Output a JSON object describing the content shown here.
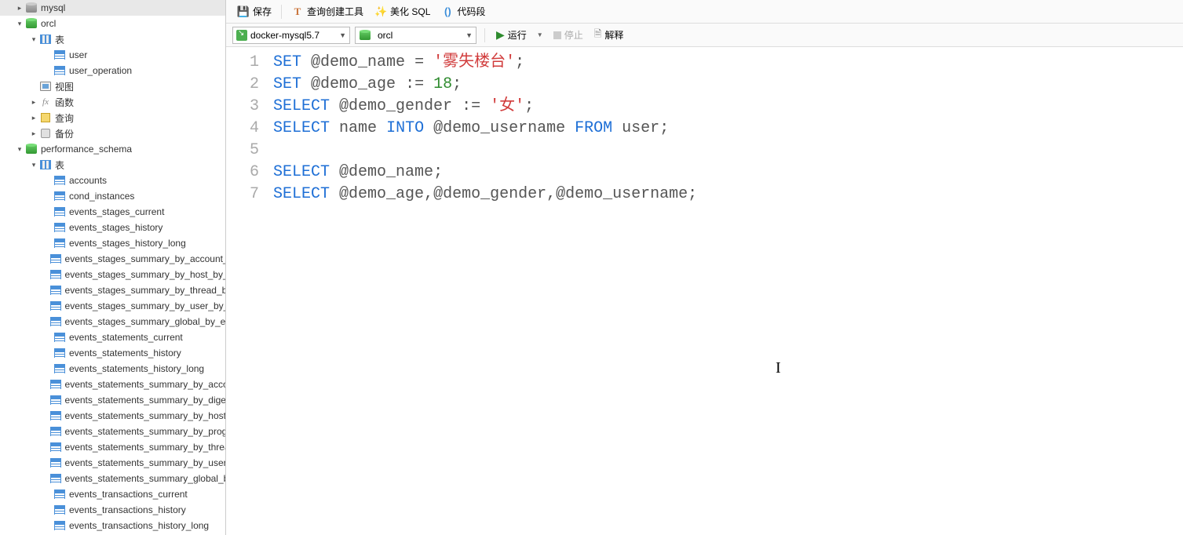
{
  "sidebar": {
    "nodes": [
      {
        "indent": 1,
        "toggle": "▸",
        "iconClass": "icon-db-grey",
        "iconName": "database-icon",
        "label": "mysql"
      },
      {
        "indent": 1,
        "toggle": "▾",
        "iconClass": "icon-db",
        "iconName": "database-icon",
        "label": "orcl"
      },
      {
        "indent": 2,
        "toggle": "▾",
        "iconClass": "icon-tables",
        "iconName": "tables-icon",
        "label": "表"
      },
      {
        "indent": 3,
        "toggle": "",
        "iconClass": "icon-table",
        "iconName": "table-icon",
        "label": "user"
      },
      {
        "indent": 3,
        "toggle": "",
        "iconClass": "icon-table",
        "iconName": "table-icon",
        "label": "user_operation"
      },
      {
        "indent": 2,
        "toggle": "",
        "iconClass": "icon-view",
        "iconName": "view-icon",
        "label": "视图"
      },
      {
        "indent": 2,
        "toggle": "▸",
        "iconClass": "icon-fx",
        "iconName": "function-icon",
        "label": "函数",
        "fx": true
      },
      {
        "indent": 2,
        "toggle": "▸",
        "iconClass": "icon-query",
        "iconName": "query-icon",
        "label": "查询"
      },
      {
        "indent": 2,
        "toggle": "▸",
        "iconClass": "icon-backup",
        "iconName": "backup-icon",
        "label": "备份"
      },
      {
        "indent": 1,
        "toggle": "▾",
        "iconClass": "icon-db",
        "iconName": "database-icon",
        "label": "performance_schema"
      },
      {
        "indent": 2,
        "toggle": "▾",
        "iconClass": "icon-tables",
        "iconName": "tables-icon",
        "label": "表"
      },
      {
        "indent": 3,
        "toggle": "",
        "iconClass": "icon-table",
        "iconName": "table-icon",
        "label": "accounts"
      },
      {
        "indent": 3,
        "toggle": "",
        "iconClass": "icon-table",
        "iconName": "table-icon",
        "label": "cond_instances"
      },
      {
        "indent": 3,
        "toggle": "",
        "iconClass": "icon-table",
        "iconName": "table-icon",
        "label": "events_stages_current"
      },
      {
        "indent": 3,
        "toggle": "",
        "iconClass": "icon-table",
        "iconName": "table-icon",
        "label": "events_stages_history"
      },
      {
        "indent": 3,
        "toggle": "",
        "iconClass": "icon-table",
        "iconName": "table-icon",
        "label": "events_stages_history_long"
      },
      {
        "indent": 3,
        "toggle": "",
        "iconClass": "icon-table",
        "iconName": "table-icon",
        "label": "events_stages_summary_by_account_by_event_name"
      },
      {
        "indent": 3,
        "toggle": "",
        "iconClass": "icon-table",
        "iconName": "table-icon",
        "label": "events_stages_summary_by_host_by_event_name"
      },
      {
        "indent": 3,
        "toggle": "",
        "iconClass": "icon-table",
        "iconName": "table-icon",
        "label": "events_stages_summary_by_thread_by_event_name"
      },
      {
        "indent": 3,
        "toggle": "",
        "iconClass": "icon-table",
        "iconName": "table-icon",
        "label": "events_stages_summary_by_user_by_event_name"
      },
      {
        "indent": 3,
        "toggle": "",
        "iconClass": "icon-table",
        "iconName": "table-icon",
        "label": "events_stages_summary_global_by_event_name"
      },
      {
        "indent": 3,
        "toggle": "",
        "iconClass": "icon-table",
        "iconName": "table-icon",
        "label": "events_statements_current"
      },
      {
        "indent": 3,
        "toggle": "",
        "iconClass": "icon-table",
        "iconName": "table-icon",
        "label": "events_statements_history"
      },
      {
        "indent": 3,
        "toggle": "",
        "iconClass": "icon-table",
        "iconName": "table-icon",
        "label": "events_statements_history_long"
      },
      {
        "indent": 3,
        "toggle": "",
        "iconClass": "icon-table",
        "iconName": "table-icon",
        "label": "events_statements_summary_by_account_by_event_name"
      },
      {
        "indent": 3,
        "toggle": "",
        "iconClass": "icon-table",
        "iconName": "table-icon",
        "label": "events_statements_summary_by_digest"
      },
      {
        "indent": 3,
        "toggle": "",
        "iconClass": "icon-table",
        "iconName": "table-icon",
        "label": "events_statements_summary_by_host_by_event_name"
      },
      {
        "indent": 3,
        "toggle": "",
        "iconClass": "icon-table",
        "iconName": "table-icon",
        "label": "events_statements_summary_by_program"
      },
      {
        "indent": 3,
        "toggle": "",
        "iconClass": "icon-table",
        "iconName": "table-icon",
        "label": "events_statements_summary_by_thread_by_event_name"
      },
      {
        "indent": 3,
        "toggle": "",
        "iconClass": "icon-table",
        "iconName": "table-icon",
        "label": "events_statements_summary_by_user_by_event_name"
      },
      {
        "indent": 3,
        "toggle": "",
        "iconClass": "icon-table",
        "iconName": "table-icon",
        "label": "events_statements_summary_global_by_event_name"
      },
      {
        "indent": 3,
        "toggle": "",
        "iconClass": "icon-table",
        "iconName": "table-icon",
        "label": "events_transactions_current"
      },
      {
        "indent": 3,
        "toggle": "",
        "iconClass": "icon-table",
        "iconName": "table-icon",
        "label": "events_transactions_history"
      },
      {
        "indent": 3,
        "toggle": "",
        "iconClass": "icon-table",
        "iconName": "table-icon",
        "label": "events_transactions_history_long"
      }
    ]
  },
  "toolbar1": {
    "save": {
      "label": "保存",
      "iconGlyph": "💾"
    },
    "queryBuilder": {
      "label": "查询创建工具",
      "iconGlyph": "T"
    },
    "beautify": {
      "label": "美化 SQL",
      "iconGlyph": "✨"
    },
    "snippet": {
      "label": "代码段",
      "iconGlyph": "()"
    }
  },
  "toolbar2": {
    "connection": "docker-mysql5.7",
    "database": "orcl",
    "run": "运行",
    "stop": "停止",
    "explain": "解释"
  },
  "editor": {
    "lines": [
      [
        {
          "t": "SET",
          "c": "kw"
        },
        {
          "t": " ",
          "c": ""
        },
        {
          "t": "@demo_name",
          "c": "var"
        },
        {
          "t": " ",
          "c": ""
        },
        {
          "t": "=",
          "c": "op"
        },
        {
          "t": " ",
          "c": ""
        },
        {
          "t": "'雾失楼台'",
          "c": "str"
        },
        {
          "t": ";",
          "c": "op"
        }
      ],
      [
        {
          "t": "SET",
          "c": "kw"
        },
        {
          "t": " ",
          "c": ""
        },
        {
          "t": "@demo_age",
          "c": "var"
        },
        {
          "t": " ",
          "c": ""
        },
        {
          "t": ":=",
          "c": "op"
        },
        {
          "t": " ",
          "c": ""
        },
        {
          "t": "18",
          "c": "num"
        },
        {
          "t": ";",
          "c": "op"
        }
      ],
      [
        {
          "t": "SELECT",
          "c": "kw"
        },
        {
          "t": " ",
          "c": ""
        },
        {
          "t": "@demo_gender",
          "c": "var"
        },
        {
          "t": " ",
          "c": ""
        },
        {
          "t": ":=",
          "c": "op"
        },
        {
          "t": " ",
          "c": ""
        },
        {
          "t": "'女'",
          "c": "str"
        },
        {
          "t": ";",
          "c": "op"
        }
      ],
      [
        {
          "t": "SELECT",
          "c": "kw"
        },
        {
          "t": " ",
          "c": ""
        },
        {
          "t": "name",
          "c": "ident"
        },
        {
          "t": " ",
          "c": ""
        },
        {
          "t": "INTO",
          "c": "kw"
        },
        {
          "t": " ",
          "c": ""
        },
        {
          "t": "@demo_username",
          "c": "var"
        },
        {
          "t": " ",
          "c": ""
        },
        {
          "t": "FROM",
          "c": "kw"
        },
        {
          "t": " ",
          "c": ""
        },
        {
          "t": "user",
          "c": "ident"
        },
        {
          "t": ";",
          "c": "op"
        }
      ],
      [],
      [
        {
          "t": "SELECT",
          "c": "kw"
        },
        {
          "t": " ",
          "c": ""
        },
        {
          "t": "@demo_name",
          "c": "var"
        },
        {
          "t": ";",
          "c": "op"
        }
      ],
      [
        {
          "t": "SELECT",
          "c": "kw"
        },
        {
          "t": " ",
          "c": ""
        },
        {
          "t": "@demo_age",
          "c": "var"
        },
        {
          "t": ",",
          "c": "op"
        },
        {
          "t": "@demo_gender",
          "c": "var"
        },
        {
          "t": ",",
          "c": "op"
        },
        {
          "t": "@demo_username",
          "c": "var"
        },
        {
          "t": ";",
          "c": "op"
        }
      ]
    ]
  }
}
